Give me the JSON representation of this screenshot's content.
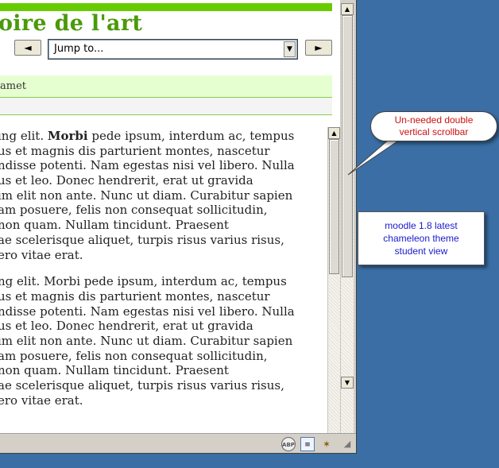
{
  "page": {
    "title": "oire de l'art",
    "jump_select": "Jump to...",
    "prev_label": "◄",
    "next_label": "►",
    "band_text": "amet",
    "paragraphs": [
      [
        "ing elit. ",
        "us et magnis dis parturient montes, nascetur",
        "ndisse potenti. Nam egestas nisi vel libero. Nulla",
        "us et leo. Donec hendrerit, erat ut gravida",
        "im elit non ante. Nunc ut diam. Curabitur sapien",
        "am posuere, felis non consequat sollicitudin,",
        "non quam. Nullam tincidunt. Praesent",
        "ae scelerisque aliquet, turpis risus varius risus,",
        "ero vitae erat."
      ],
      [
        "ng elit. Morbi pede ipsum, interdum ac, tempus",
        "us et magnis dis parturient montes, nascetur",
        "ndisse potenti. Nam egestas nisi vel libero. Nulla",
        "us et leo. Donec hendrerit, erat ut gravida",
        "im elit non ante. Nunc ut diam. Curabitur sapien",
        "am posuere, felis non consequat sollicitudin,",
        "non quam. Nullam tincidunt. Praesent",
        "ae scelerisque aliquet, turpis risus varius risus,",
        "ero vitae erat."
      ]
    ],
    "bold_word": "Morbi",
    "bold_rest": " pede ipsum, interdum ac, tempus"
  },
  "annotations": {
    "bubble_lines": [
      "Un-needed double",
      "vertical scrollbar"
    ],
    "note_lines": [
      "moodle 1.8 latest",
      "chameleon theme",
      "student view"
    ]
  },
  "status_icons": [
    "adblock-icon",
    "page-icon",
    "tools-icon"
  ],
  "colors": {
    "title": "#4a9a0a",
    "bar": "#66cc00",
    "bubble_text": "#cc1111",
    "note_text": "#1a1acc",
    "desktop": "#3a6ea5"
  }
}
